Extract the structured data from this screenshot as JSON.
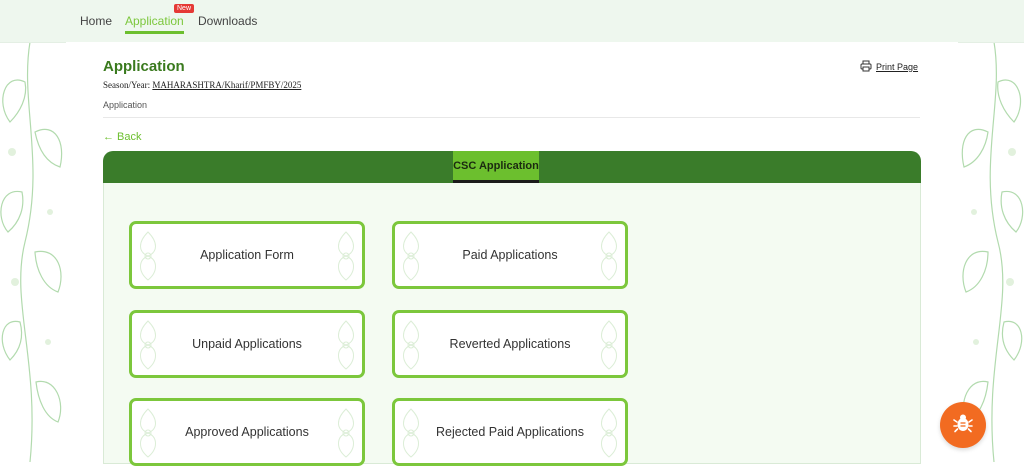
{
  "nav": {
    "items": [
      {
        "label": "Home"
      },
      {
        "label": "Application",
        "active": true,
        "badge": "New"
      },
      {
        "label": "Downloads"
      }
    ]
  },
  "header": {
    "title": "Application",
    "season_label": "Season/Year:",
    "season_value": "MAHARASHTRA/Kharif/PMFBY/2025",
    "breadcrumb": "Application",
    "print_label": "Print Page",
    "print_icon": "printer-icon"
  },
  "back_label": "← Back",
  "panel": {
    "tab_label": "CSC Application",
    "cards": [
      {
        "label": "Application Form"
      },
      {
        "label": "Paid Applications"
      },
      {
        "label": "Unpaid Applications"
      },
      {
        "label": "Reverted Applications"
      },
      {
        "label": "Approved Applications"
      },
      {
        "label": "Rejected Paid Applications"
      }
    ]
  },
  "floating_button_icon": "bug-icon",
  "colors": {
    "accent_green": "#6cbf2e",
    "dark_green": "#3a7c2a",
    "badge_red": "#e53935",
    "bug_orange": "#f26b21"
  }
}
